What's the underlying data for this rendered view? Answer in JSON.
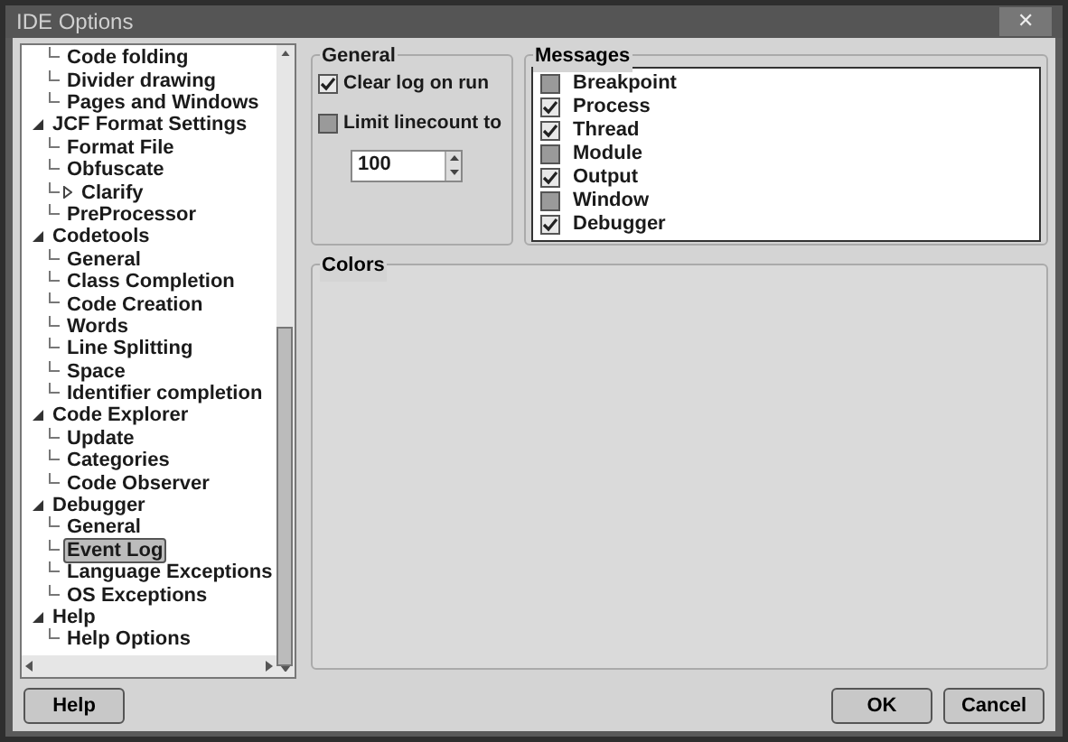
{
  "window": {
    "title": "IDE Options",
    "close": "✕"
  },
  "tree": {
    "items": [
      {
        "children": [
          {
            "label": "Code folding",
            "selected": false
          },
          {
            "label": "Divider drawing",
            "selected": false
          },
          {
            "label": "Pages and Windows",
            "selected": false
          }
        ]
      },
      {
        "label": "JCF Format Settings",
        "selected": false,
        "expanded": true,
        "children": [
          {
            "label": "Format File",
            "selected": false
          },
          {
            "label": "Obfuscate",
            "selected": false
          },
          {
            "label": "Clarify",
            "selected": false,
            "expanded": false
          },
          {
            "label": "PreProcessor",
            "selected": false
          }
        ]
      },
      {
        "label": "Codetools",
        "selected": false,
        "expanded": true,
        "children": [
          {
            "label": "General",
            "selected": false
          },
          {
            "label": "Class Completion",
            "selected": false
          },
          {
            "label": "Code Creation",
            "selected": false
          },
          {
            "label": "Words",
            "selected": false
          },
          {
            "label": "Line Splitting",
            "selected": false
          },
          {
            "label": "Space",
            "selected": false
          },
          {
            "label": "Identifier completion",
            "selected": false
          }
        ]
      },
      {
        "label": "Code Explorer",
        "selected": false,
        "expanded": true,
        "children": [
          {
            "label": "Update",
            "selected": false
          },
          {
            "label": "Categories",
            "selected": false
          },
          {
            "label": "Code Observer",
            "selected": false
          }
        ]
      },
      {
        "label": "Debugger",
        "selected": false,
        "expanded": true,
        "children": [
          {
            "label": "General",
            "selected": false
          },
          {
            "label": "Event Log",
            "selected": true
          },
          {
            "label": "Language Exceptions",
            "selected": false
          },
          {
            "label": "OS Exceptions",
            "selected": false
          }
        ]
      },
      {
        "label": "Help",
        "selected": false,
        "expanded": true,
        "children": [
          {
            "label": "Help Options",
            "selected": false
          }
        ]
      }
    ]
  },
  "general": {
    "title": "General",
    "options": [
      {
        "label": "Clear log on run",
        "checked": true
      },
      {
        "label": "Limit linecount to",
        "checked": false
      }
    ],
    "linecount": "100"
  },
  "messages": {
    "title": "Messages",
    "items": [
      {
        "label": "Breakpoint",
        "checked": false
      },
      {
        "label": "Process",
        "checked": true
      },
      {
        "label": "Thread",
        "checked": true
      },
      {
        "label": "Module",
        "checked": false
      },
      {
        "label": "Output",
        "checked": true
      },
      {
        "label": "Window",
        "checked": false
      },
      {
        "label": "Debugger",
        "checked": true
      }
    ]
  },
  "colors": {
    "title": "Colors"
  },
  "buttons": {
    "help": "Help",
    "ok": "OK",
    "cancel": "Cancel"
  }
}
